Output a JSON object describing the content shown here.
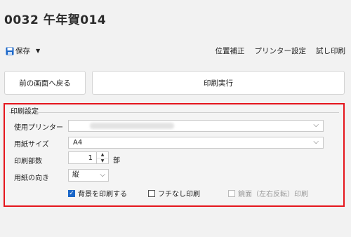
{
  "page_title": "0032 午年賀014",
  "toolbar": {
    "save_label": "保存",
    "right_items": [
      "位置補正",
      "プリンター設定",
      "試し印刷"
    ]
  },
  "buttons": {
    "back_label": "前の画面へ戻る",
    "print_label": "印刷実行"
  },
  "print_settings": {
    "legend": "印刷設定",
    "printer_label": "使用プリンター",
    "paper_size_label": "用紙サイズ",
    "paper_size_value": "A4",
    "copies_label": "印刷部数",
    "copies_value": "1",
    "copies_unit": "部",
    "orientation_label": "用紙の向き",
    "orientation_value": "縦",
    "options": [
      {
        "label": "背景を印刷する",
        "checked": true,
        "disabled": false
      },
      {
        "label": "フチなし印刷",
        "checked": false,
        "disabled": false
      },
      {
        "label": "鏡面（左右反転）印刷",
        "checked": false,
        "disabled": true
      }
    ]
  },
  "colors": {
    "highlight_border": "#e5161d",
    "checkbox_accent": "#1a66c8",
    "save_icon": "#1a66c8"
  }
}
